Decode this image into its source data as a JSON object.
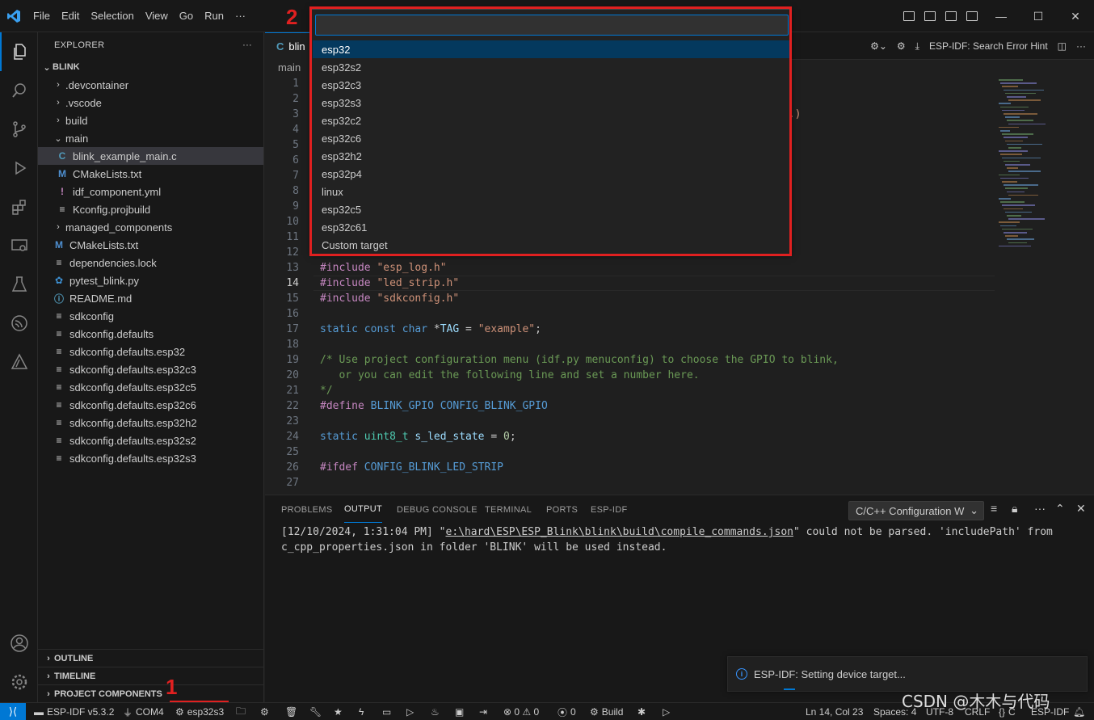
{
  "menu": [
    "File",
    "Edit",
    "Selection",
    "View",
    "Go",
    "Run",
    "···"
  ],
  "window_controls": {
    "minimize": "—",
    "maximize": "☐",
    "close": "✕"
  },
  "sidebar": {
    "title": "EXPLORER",
    "more": "···",
    "root": "BLINK",
    "items": [
      {
        "label": ".devcontainer",
        "chev": "›",
        "icon": "",
        "indent": 1
      },
      {
        "label": ".vscode",
        "chev": "›",
        "icon": "",
        "indent": 1
      },
      {
        "label": "build",
        "chev": "›",
        "icon": "",
        "indent": 1
      },
      {
        "label": "main",
        "chev": "⌄",
        "icon": "",
        "indent": 1
      },
      {
        "label": "blink_example_main.c",
        "chev": "",
        "icon": "C",
        "indent": 2
      },
      {
        "label": "CMakeLists.txt",
        "chev": "",
        "icon": "M",
        "indent": 2
      },
      {
        "label": "idf_component.yml",
        "chev": "",
        "icon": "!",
        "indent": 2
      },
      {
        "label": "Kconfig.projbuild",
        "chev": "",
        "icon": "≡",
        "indent": 2
      },
      {
        "label": "managed_components",
        "chev": "›",
        "icon": "",
        "indent": 1
      },
      {
        "label": "CMakeLists.txt",
        "chev": "",
        "icon": "M",
        "indent": 1
      },
      {
        "label": "dependencies.lock",
        "chev": "",
        "icon": "≡",
        "indent": 1
      },
      {
        "label": "pytest_blink.py",
        "chev": "",
        "icon": "✿",
        "indent": 1
      },
      {
        "label": "README.md",
        "chev": "",
        "icon": "ⓘ",
        "indent": 1
      },
      {
        "label": "sdkconfig",
        "chev": "",
        "icon": "≡",
        "indent": 1
      },
      {
        "label": "sdkconfig.defaults",
        "chev": "",
        "icon": "≡",
        "indent": 1
      },
      {
        "label": "sdkconfig.defaults.esp32",
        "chev": "",
        "icon": "≡",
        "indent": 1
      },
      {
        "label": "sdkconfig.defaults.esp32c3",
        "chev": "",
        "icon": "≡",
        "indent": 1
      },
      {
        "label": "sdkconfig.defaults.esp32c5",
        "chev": "",
        "icon": "≡",
        "indent": 1
      },
      {
        "label": "sdkconfig.defaults.esp32c6",
        "chev": "",
        "icon": "≡",
        "indent": 1
      },
      {
        "label": "sdkconfig.defaults.esp32h2",
        "chev": "",
        "icon": "≡",
        "indent": 1
      },
      {
        "label": "sdkconfig.defaults.esp32s2",
        "chev": "",
        "icon": "≡",
        "indent": 1
      },
      {
        "label": "sdkconfig.defaults.esp32s3",
        "chev": "",
        "icon": "≡",
        "indent": 1
      }
    ],
    "sections": [
      "OUTLINE",
      "TIMELINE",
      "PROJECT COMPONENTS"
    ]
  },
  "editor": {
    "tab_label": "blin",
    "tab_icon": "C",
    "tab_actions": "ESP-IDF: Search Error Hint",
    "breadcrumb": "main",
    "hidden_fragment": "n.)",
    "line_numbers": [
      "1",
      "2",
      "3",
      "4",
      "5",
      "6",
      "7",
      "8",
      "9",
      "10",
      "11",
      "12",
      "13",
      "14",
      "15",
      "16",
      "17",
      "18",
      "19",
      "20",
      "21",
      "22",
      "23",
      "24",
      "25",
      "26",
      "27"
    ],
    "current_line": "14",
    "lines": {
      "l13": {
        "a": "#include",
        "b": " \"esp_log.h\""
      },
      "l14": {
        "a": "#include",
        "b": " \"led_strip.h\""
      },
      "l15": {
        "a": "#include",
        "b": " \"sdkconfig.h\""
      },
      "l17": {
        "a": "static const char",
        "b": " *",
        "c": "TAG",
        "d": " = ",
        "e": "\"example\"",
        "f": ";"
      },
      "l19": "/* Use project configuration menu (idf.py menuconfig) to choose the GPIO to blink,",
      "l20": "   or you can edit the following line and set a number here.",
      "l21": "*/",
      "l22": {
        "a": "#define",
        "b": " BLINK_GPIO CONFIG_BLINK_GPIO"
      },
      "l24": {
        "a": "static",
        "b": " uint8_t",
        "c": " s_led_state",
        "d": " = ",
        "e": "0",
        "f": ";"
      },
      "l26": {
        "a": "#ifdef",
        "b": " CONFIG_BLINK_LED_STRIP"
      }
    }
  },
  "quickpick": {
    "value": "",
    "items": [
      "esp32",
      "esp32s2",
      "esp32c3",
      "esp32s3",
      "esp32c2",
      "esp32c6",
      "esp32h2",
      "esp32p4",
      "linux",
      "esp32c5",
      "esp32c61",
      "Custom target"
    ],
    "selected_index": 0
  },
  "annotations": {
    "label1": "1",
    "label2": "2"
  },
  "panel": {
    "tabs": [
      "PROBLEMS",
      "OUTPUT",
      "DEBUG CONSOLE",
      "TERMINAL",
      "PORTS",
      "ESP-IDF"
    ],
    "active_tab": "OUTPUT",
    "channel": "C/C++ Configuration W",
    "output_prefix": "[12/10/2024, 1:31:04 PM] \"",
    "output_path": "e:\\hard\\ESP\\ESP_Blink\\blink\\build\\compile_commands.json",
    "output_suffix": "\" could not be parsed. 'includePath' from c_cpp_properties.json in folder 'BLINK' will be used instead."
  },
  "notification": {
    "text": "ESP-IDF: Setting device target..."
  },
  "statusbar": {
    "remote": "⟩⟨",
    "idf_version": "ESP-IDF v5.3.2",
    "port": "COM4",
    "target": "esp32s3",
    "problems": "⊗ 0 ⚠ 0",
    "ports_count": "0",
    "build": "Build",
    "cursor": "Ln 14, Col 23",
    "spaces": "Spaces: 4",
    "encoding": "UTF-8",
    "eol": "CRLF",
    "lang": "C",
    "idf": "ESP-IDF"
  },
  "watermark": "CSDN @木木与代码",
  "colors": {
    "accent": "#0078d4",
    "annotation": "#e02020",
    "selection": "#04395e"
  }
}
